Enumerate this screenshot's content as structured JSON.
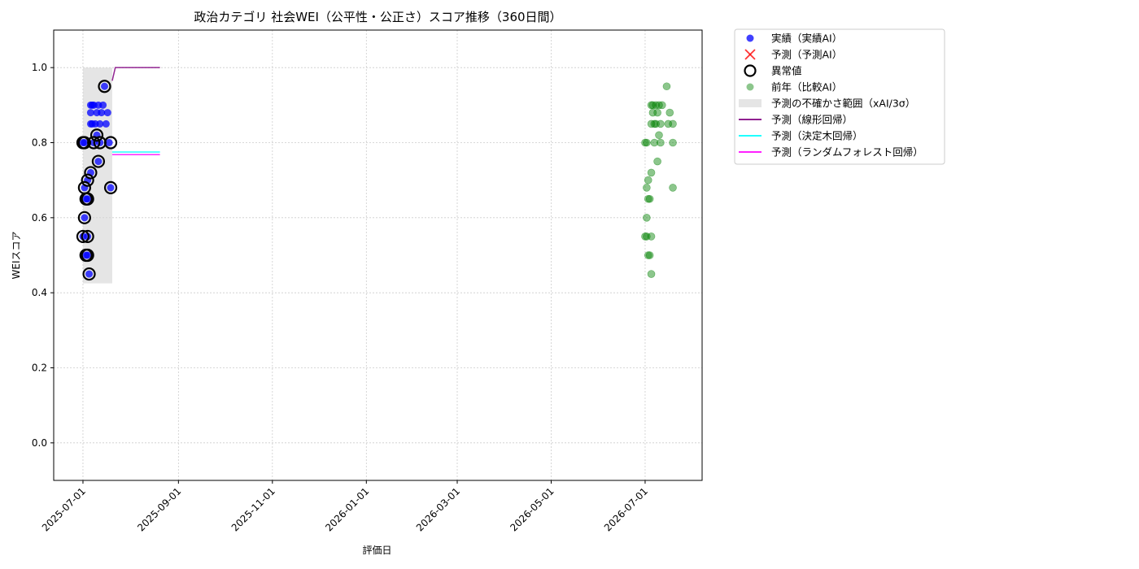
{
  "chart_data": {
    "type": "scatter",
    "title": "政治カテゴリ 社会WEI（公平性・公正さ）スコア推移（360日間）",
    "xlabel": "評価日",
    "ylabel": "WEIスコア",
    "xlim": [
      "2025-06-12",
      "2026-08-07"
    ],
    "ylim": [
      -0.1,
      1.1
    ],
    "x_ticks": [
      "2025-07-01",
      "2025-09-01",
      "2025-11-01",
      "2026-01-01",
      "2026-03-01",
      "2026-05-01",
      "2026-07-01"
    ],
    "y_ticks": [
      "0.0",
      "0.2",
      "0.4",
      "0.6",
      "0.8",
      "1.0"
    ],
    "grid": true,
    "legend_position": "outside-right-top",
    "legend": [
      {
        "label": "実績（実績AI）",
        "marker": "dot",
        "color": "#0000ff"
      },
      {
        "label": "予測（予測AI）",
        "marker": "x",
        "color": "#ff0000"
      },
      {
        "label": "異常値",
        "marker": "ring",
        "color": "#000000"
      },
      {
        "label": "前年（比較AI）",
        "marker": "dot",
        "color": "#008000"
      },
      {
        "label": "予測の不確かさ範囲（xAI/3σ）",
        "marker": "band",
        "color": "#d3d3d3"
      },
      {
        "label": "予測（線形回帰）",
        "marker": "line",
        "color": "#800080"
      },
      {
        "label": "予測（決定木回帰）",
        "marker": "line",
        "color": "#00ffff"
      },
      {
        "label": "予測（ランダムフォレスト回帰）",
        "marker": "line",
        "color": "#ff00ff"
      }
    ],
    "uncertainty_band": {
      "x": [
        "2025-07-01",
        "2025-07-20"
      ],
      "y": [
        0.425,
        1.0
      ],
      "color": "#d3d3d3"
    },
    "series": [
      {
        "name": "実績（実績AI）",
        "color": "#0000ff",
        "points": [
          [
            "2025-07-01",
            0.8
          ],
          [
            "2025-07-01",
            0.55
          ],
          [
            "2025-07-02",
            0.8
          ],
          [
            "2025-07-02",
            0.68
          ],
          [
            "2025-07-02",
            0.6
          ],
          [
            "2025-07-03",
            0.65
          ],
          [
            "2025-07-03",
            0.5
          ],
          [
            "2025-07-04",
            0.7
          ],
          [
            "2025-07-04",
            0.65
          ],
          [
            "2025-07-04",
            0.55
          ],
          [
            "2025-07-04",
            0.5
          ],
          [
            "2025-07-05",
            0.45
          ],
          [
            "2025-07-06",
            0.72
          ],
          [
            "2025-07-06",
            0.9
          ],
          [
            "2025-07-06",
            0.88
          ],
          [
            "2025-07-06",
            0.85
          ],
          [
            "2025-07-07",
            0.9
          ],
          [
            "2025-07-07",
            0.85
          ],
          [
            "2025-07-08",
            0.8
          ],
          [
            "2025-07-08",
            0.9
          ],
          [
            "2025-07-09",
            0.85
          ],
          [
            "2025-07-10",
            0.88
          ],
          [
            "2025-07-10",
            0.82
          ],
          [
            "2025-07-11",
            0.75
          ],
          [
            "2025-07-11",
            0.9
          ],
          [
            "2025-07-12",
            0.85
          ],
          [
            "2025-07-12",
            0.8
          ],
          [
            "2025-07-13",
            0.88
          ],
          [
            "2025-07-14",
            0.9
          ],
          [
            "2025-07-15",
            0.95
          ],
          [
            "2025-07-16",
            0.85
          ],
          [
            "2025-07-17",
            0.88
          ],
          [
            "2025-07-18",
            0.8
          ],
          [
            "2025-07-19",
            0.68
          ]
        ]
      },
      {
        "name": "異常値",
        "color": "#000000",
        "points": [
          [
            "2025-07-01",
            0.8
          ],
          [
            "2025-07-01",
            0.55
          ],
          [
            "2025-07-02",
            0.8
          ],
          [
            "2025-07-02",
            0.68
          ],
          [
            "2025-07-02",
            0.6
          ],
          [
            "2025-07-03",
            0.65
          ],
          [
            "2025-07-03",
            0.5
          ],
          [
            "2025-07-04",
            0.7
          ],
          [
            "2025-07-04",
            0.65
          ],
          [
            "2025-07-04",
            0.55
          ],
          [
            "2025-07-04",
            0.5
          ],
          [
            "2025-07-05",
            0.45
          ],
          [
            "2025-07-06",
            0.72
          ],
          [
            "2025-07-08",
            0.8
          ],
          [
            "2025-07-10",
            0.82
          ],
          [
            "2025-07-11",
            0.75
          ],
          [
            "2025-07-12",
            0.8
          ],
          [
            "2025-07-15",
            0.95
          ],
          [
            "2025-07-19",
            0.8
          ],
          [
            "2025-07-19",
            0.68
          ]
        ]
      },
      {
        "name": "前年（比較AI）",
        "color": "#008000",
        "points": [
          [
            "2026-07-01",
            0.8
          ],
          [
            "2026-07-01",
            0.55
          ],
          [
            "2026-07-02",
            0.8
          ],
          [
            "2026-07-02",
            0.68
          ],
          [
            "2026-07-02",
            0.6
          ],
          [
            "2026-07-02",
            0.55
          ],
          [
            "2026-07-03",
            0.65
          ],
          [
            "2026-07-03",
            0.5
          ],
          [
            "2026-07-03",
            0.7
          ],
          [
            "2026-07-04",
            0.65
          ],
          [
            "2026-07-04",
            0.5
          ],
          [
            "2026-07-05",
            0.55
          ],
          [
            "2026-07-05",
            0.45
          ],
          [
            "2026-07-05",
            0.72
          ],
          [
            "2026-07-05",
            0.9
          ],
          [
            "2026-07-05",
            0.85
          ],
          [
            "2026-07-06",
            0.88
          ],
          [
            "2026-07-06",
            0.9
          ],
          [
            "2026-07-07",
            0.85
          ],
          [
            "2026-07-07",
            0.8
          ],
          [
            "2026-07-08",
            0.9
          ],
          [
            "2026-07-08",
            0.85
          ],
          [
            "2026-07-09",
            0.88
          ],
          [
            "2026-07-09",
            0.75
          ],
          [
            "2026-07-10",
            0.9
          ],
          [
            "2026-07-10",
            0.82
          ],
          [
            "2026-07-11",
            0.85
          ],
          [
            "2026-07-11",
            0.8
          ],
          [
            "2026-07-12",
            0.9
          ],
          [
            "2026-07-15",
            0.95
          ],
          [
            "2026-07-16",
            0.85
          ],
          [
            "2026-07-17",
            0.88
          ],
          [
            "2026-07-19",
            0.8
          ],
          [
            "2026-07-19",
            0.68
          ],
          [
            "2026-07-19",
            0.85
          ]
        ]
      }
    ],
    "lines": [
      {
        "name": "予測（線形回帰）",
        "color": "#800080",
        "points": [
          [
            "2025-07-20",
            0.965
          ],
          [
            "2025-07-22",
            1.0
          ],
          [
            "2025-08-20",
            1.0
          ]
        ]
      },
      {
        "name": "予測（決定木回帰）",
        "color": "#00ffff",
        "points": [
          [
            "2025-07-20",
            0.775
          ],
          [
            "2025-08-20",
            0.775
          ]
        ]
      },
      {
        "name": "予測（ランダムフォレスト回帰）",
        "color": "#ff00ff",
        "points": [
          [
            "2025-07-20",
            0.768
          ],
          [
            "2025-08-20",
            0.768
          ]
        ]
      }
    ]
  }
}
